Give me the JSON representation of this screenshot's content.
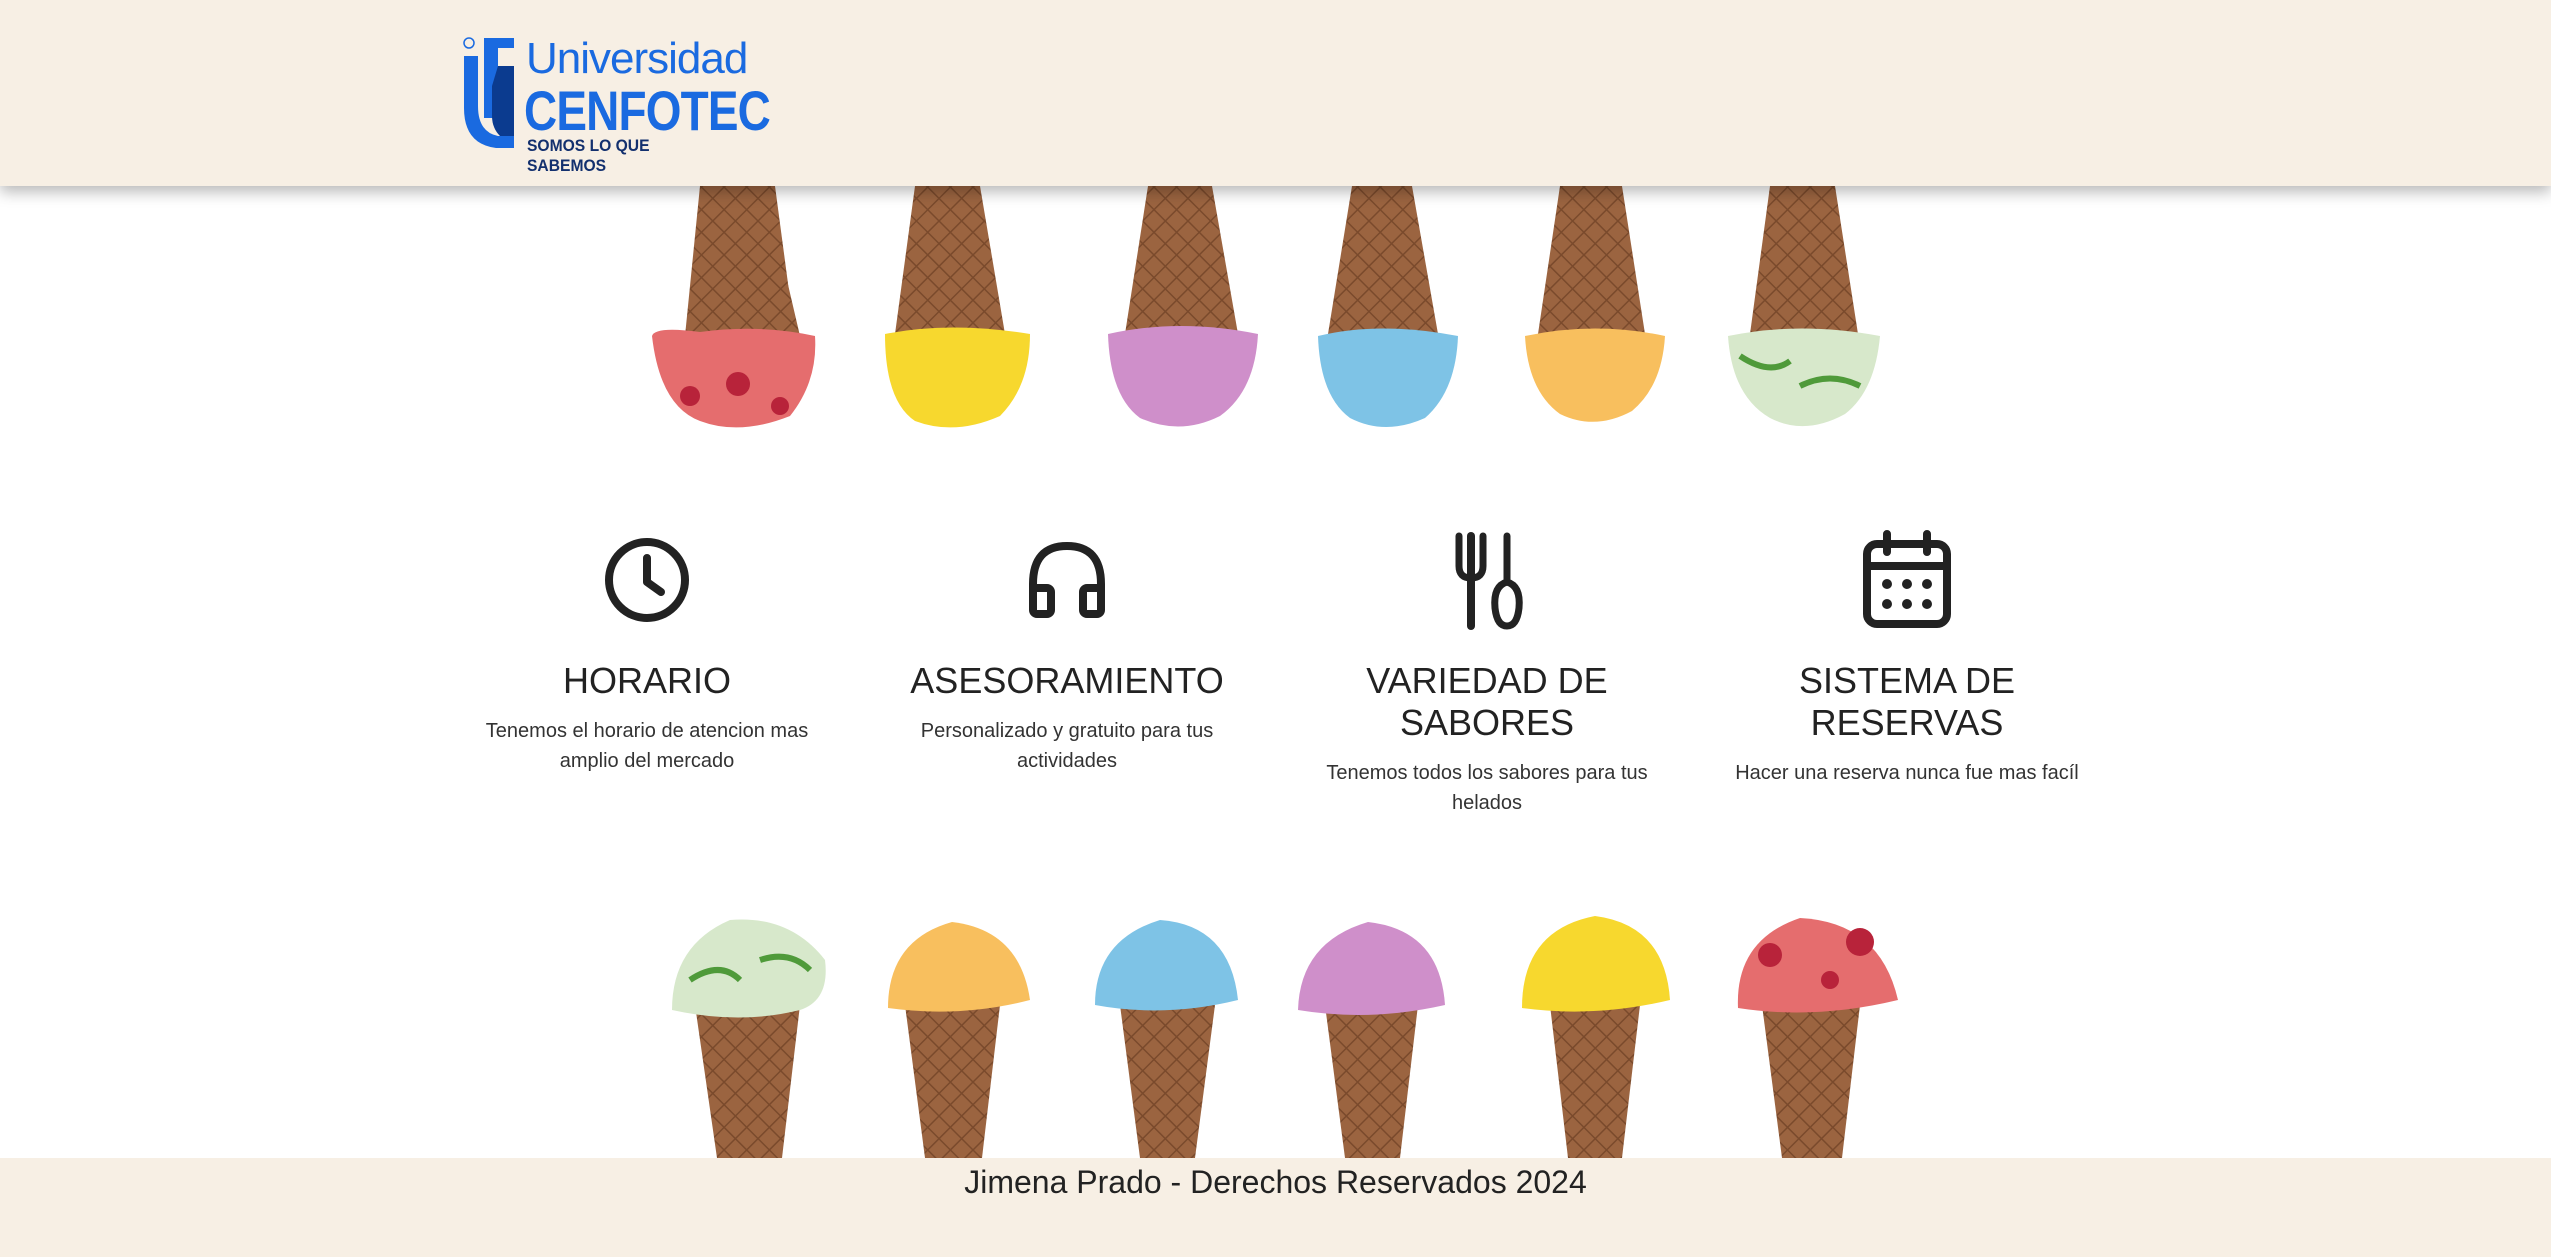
{
  "header": {
    "logo_line1": "Universidad",
    "logo_line2": "CENFOTEC",
    "logo_tagline": "SOMOS LO QUE SABEMOS",
    "brand_color": "#1a6ae0"
  },
  "cones": {
    "top_flavors": [
      "raspberry",
      "lemon",
      "blueberry",
      "blue-mint",
      "mango",
      "pistachio"
    ],
    "bottom_flavors": [
      "pistachio",
      "mango",
      "blue-mint",
      "blueberry",
      "lemon",
      "raspberry"
    ],
    "flavor_colors": {
      "raspberry": "#e56d6e",
      "lemon": "#f7d82e",
      "blueberry": "#cf8fca",
      "blue-mint": "#7ec3e6",
      "mango": "#f8bf5e",
      "pistachio": "#d7e8cb"
    }
  },
  "features": [
    {
      "icon": "clock-icon",
      "title": "HORARIO",
      "desc": "Tenemos el horario de atencion mas amplio del mercado"
    },
    {
      "icon": "headphones-icon",
      "title": "ASESORAMIENTO",
      "desc": "Personalizado y gratuito para tus actividades"
    },
    {
      "icon": "utensils-icon",
      "title": "VARIEDAD DE SABORES",
      "desc": "Tenemos todos los sabores para tus helados"
    },
    {
      "icon": "calendar-icon",
      "title": "SISTEMA DE RESERVAS",
      "desc": "Hacer una reserva nunca fue mas facíl"
    }
  ],
  "footer": {
    "text": "Jimena Prado - Derechos Reservados 2024"
  }
}
